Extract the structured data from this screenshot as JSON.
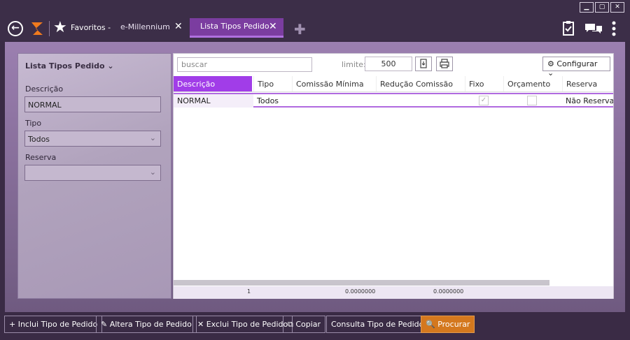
{
  "window": {
    "buttons": [
      "minimize",
      "maximize",
      "close"
    ]
  },
  "topbar": {
    "favorites_label": "Favoritos -",
    "tabs": [
      {
        "label": "e-Millennium",
        "active": false
      },
      {
        "label": "Lista Tipos Pedido",
        "active": true
      }
    ]
  },
  "filter": {
    "title": "Lista Tipos Pedido",
    "descricao_label": "Descrição",
    "descricao_value": "NORMAL",
    "tipo_label": "Tipo",
    "tipo_value": "Todos",
    "reserva_label": "Reserva",
    "reserva_value": ""
  },
  "grid": {
    "search_placeholder": "buscar",
    "limit_label": "limite:",
    "limit_value": "500",
    "config_label": "Configurar",
    "columns": [
      "Descrição",
      "Tipo",
      "Comissão Mínima",
      "Redução Comissão",
      "Fixo",
      "Orçamento",
      "Reserva"
    ],
    "rows": [
      {
        "descricao": "NORMAL",
        "tipo": "Todos",
        "comissao_minima": "",
        "reducao_comissao": "",
        "fixo": true,
        "orcamento": false,
        "reserva": "Não Reservar"
      }
    ],
    "footer": {
      "count": "1",
      "comissao_total": "0.0000000",
      "reducao_total": "0.0000000"
    }
  },
  "actions": {
    "inclui": "Inclui Tipo de Pedido",
    "altera": "Altera Tipo de Pedido",
    "exclui": "Exclui Tipo de Pedido",
    "copiar": "Copiar",
    "consulta": "Consulta Tipo de Pedido",
    "procurar": "Procurar"
  },
  "colors": {
    "accent": "#a13de8",
    "primary_button": "#d4781e",
    "frame": "#3a2b45"
  }
}
